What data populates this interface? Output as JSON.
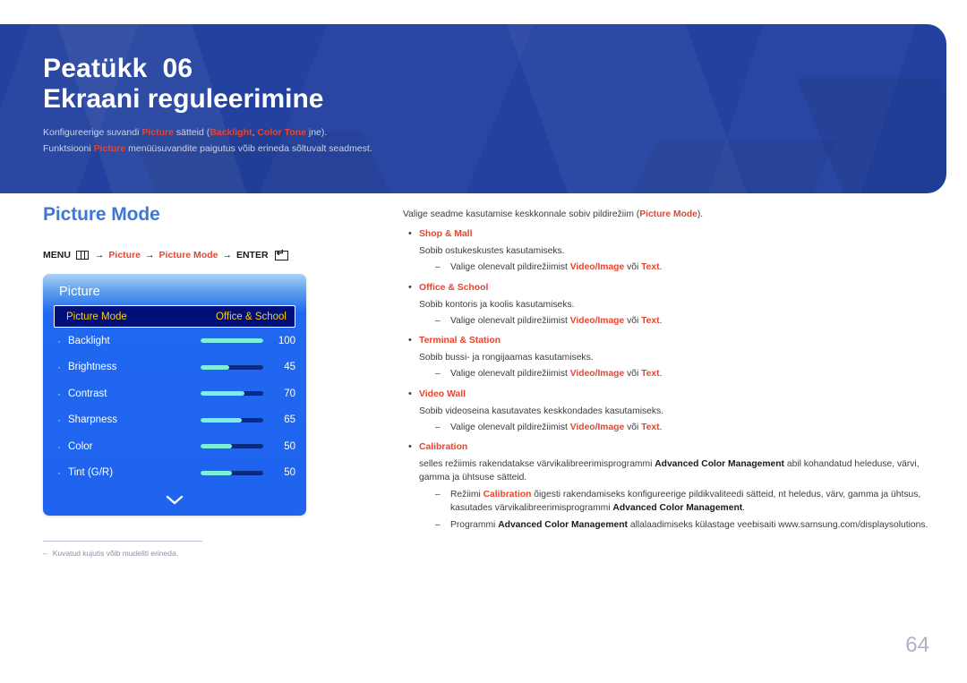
{
  "banner": {
    "chapter_label": "Peatükk  06",
    "chapter_title": "Ekraani reguleerimine",
    "sub_line1_a": "Konfigureerige suvandi ",
    "sub_line1_b": "Picture",
    "sub_line1_c": " sätteid (",
    "sub_line1_d": "Backlight",
    "sub_line1_e": ", ",
    "sub_line1_f": "Color Tone",
    "sub_line1_g": " jne).",
    "sub_line2_a": "Funktsiooni ",
    "sub_line2_b": "Picture",
    "sub_line2_c": " menüüsuvandite paigutus võib erineda sõltuvalt seadmest."
  },
  "left": {
    "section_title": "Picture Mode",
    "menu_path": {
      "menu_label": "MENU",
      "menu_icon": "menu-grid-icon",
      "arrow": "→",
      "step1": "Picture",
      "step2": "Picture Mode",
      "enter_label": "ENTER",
      "enter_icon": "enter-return-icon"
    },
    "osd": {
      "title": "Picture",
      "selected_row": {
        "label": "Picture Mode",
        "value": "Office & School"
      },
      "rows": [
        {
          "label": "Backlight",
          "value": "100",
          "fill": 100
        },
        {
          "label": "Brightness",
          "value": "45",
          "fill": 45
        },
        {
          "label": "Contrast",
          "value": "70",
          "fill": 70
        },
        {
          "label": "Sharpness",
          "value": "65",
          "fill": 65
        },
        {
          "label": "Color",
          "value": "50",
          "fill": 50
        },
        {
          "label": "Tint (G/R)",
          "value": "50",
          "fill": 50
        }
      ],
      "scroll_icon": "chevron-down-icon"
    },
    "footnote": {
      "dash": "‒",
      "text": "Kuvatud kujutis võib mudeliti erineda."
    }
  },
  "right": {
    "intro_a": "Valige seadme kasutamise keskkonnale sobiv pildirežiim (",
    "intro_b": "Picture Mode",
    "intro_c": ").",
    "bullet_marker": "•",
    "dash_marker": "‒",
    "items": [
      {
        "title": "Shop & Mall",
        "desc": "Sobib ostukeskustes kasutamiseks.",
        "sub_a": "Valige olenevalt pildirežiimist ",
        "sub_b": "Video/Image",
        "sub_c": " või ",
        "sub_d": "Text",
        "sub_e": "."
      },
      {
        "title": "Office & School",
        "desc": "Sobib kontoris ja koolis kasutamiseks.",
        "sub_a": "Valige olenevalt pildirežiimist ",
        "sub_b": "Video/Image",
        "sub_c": " või ",
        "sub_d": "Text",
        "sub_e": "."
      },
      {
        "title": "Terminal & Station",
        "desc": "Sobib bussi- ja rongijaamas kasutamiseks.",
        "sub_a": "Valige olenevalt pildirežiimist ",
        "sub_b": "Video/Image",
        "sub_c": " või ",
        "sub_d": "Text",
        "sub_e": "."
      },
      {
        "title": "Video Wall",
        "desc": "Sobib videoseina kasutavates keskkondades kasutamiseks.",
        "sub_a": "Valige olenevalt pildirežiimist ",
        "sub_b": "Video/Image",
        "sub_c": " või ",
        "sub_d": "Text",
        "sub_e": "."
      }
    ],
    "calibration": {
      "title": "Calibration",
      "desc_a": "selles režiimis rakendatakse värvikalibreerimisprogrammi ",
      "desc_b": "Advanced Color Management",
      "desc_c": " abil kohandatud heleduse, värvi, gamma ja ühtsuse sätteid.",
      "sub1_a": "Režiimi ",
      "sub1_b": "Calibration",
      "sub1_c": " õigesti rakendamiseks konfigureerige pildikvaliteedi sätteid, nt heledus, värv, gamma ja ühtsus, kasutades värvikalibreerimisprogrammi ",
      "sub1_d": "Advanced Color Management",
      "sub1_e": ".",
      "sub2_a": "Programmi ",
      "sub2_b": "Advanced Color Management",
      "sub2_c": " allalaadimiseks külastage veebisaiti www.samsung.com/displaysolutions."
    }
  },
  "page_number": "64",
  "colors": {
    "banner_blue": "#23429f",
    "accent_red": "#e8442e",
    "section_blue": "#3d78d8",
    "osd_blue": "#1f63ee",
    "osd_selected_bg": "#000e7a",
    "osd_selected_text": "#ffd000",
    "slider_fill": "#7df0dd"
  }
}
